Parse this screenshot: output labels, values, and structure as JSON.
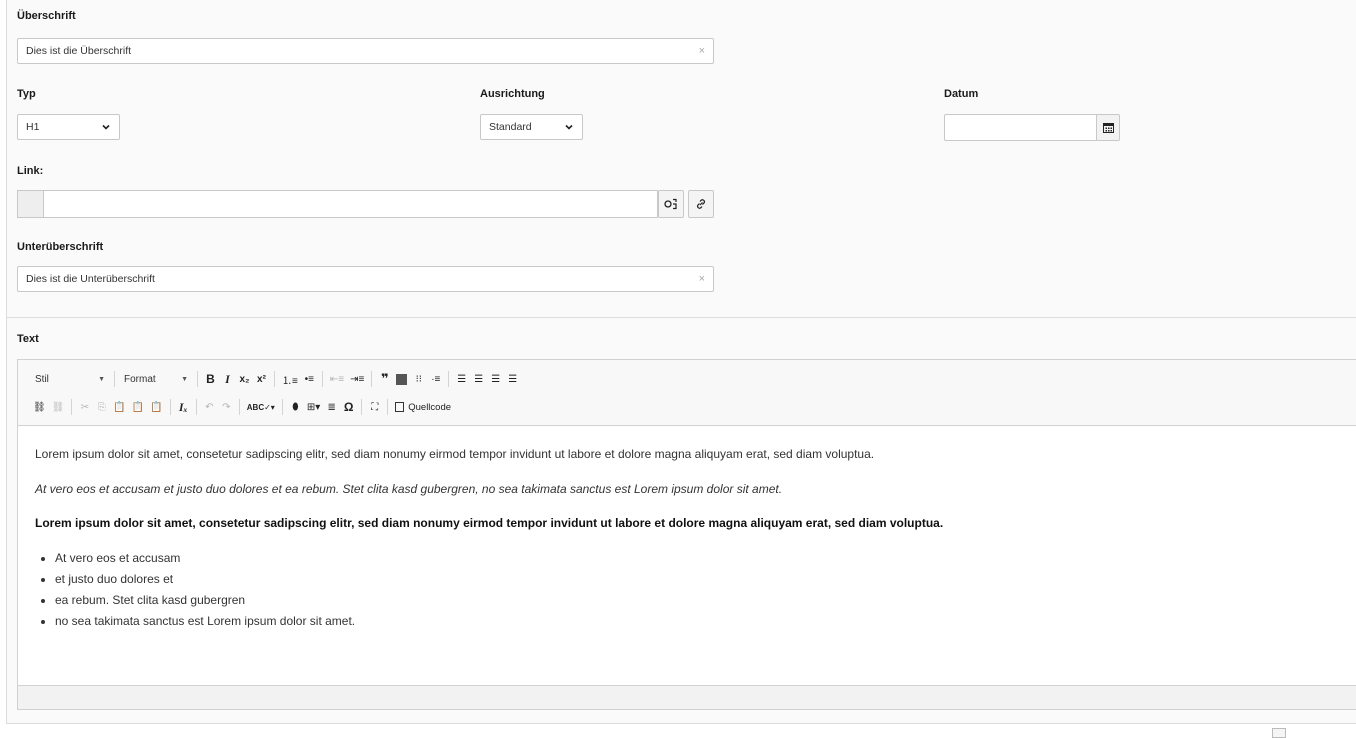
{
  "headline": {
    "label": "Überschrift",
    "value": "Dies ist die Überschrift",
    "clear": "×"
  },
  "type": {
    "label": "Typ",
    "selected": "H1"
  },
  "alignment": {
    "label": "Ausrichtung",
    "selected": "Standard"
  },
  "date": {
    "label": "Datum",
    "value": ""
  },
  "link": {
    "label": "Link:",
    "value": ""
  },
  "subheadline": {
    "label": "Unterüberschrift",
    "value": "Dies ist die Unterüberschrift",
    "clear": "×"
  },
  "text": {
    "label": "Text"
  },
  "editor": {
    "style_combo": "Stil",
    "format_combo": "Format",
    "source_label": "Quellcode",
    "paragraphs": [
      "Lorem ipsum dolor sit amet, consetetur sadipscing elitr, sed diam nonumy eirmod tempor invidunt ut labore et dolore magna aliquyam erat, sed diam voluptua.",
      "At vero eos et accusam et justo duo dolores et ea rebum. Stet clita kasd gubergren, no sea takimata sanctus est Lorem ipsum dolor sit amet.",
      "Lorem ipsum dolor sit amet, consetetur sadipscing elitr, sed diam nonumy eirmod tempor invidunt ut labore et dolore magna aliquyam erat, sed diam voluptua."
    ],
    "list": [
      "At vero eos et accusam",
      "et justo duo dolores et",
      "ea rebum. Stet clita kasd gubergren",
      "no sea takimata sanctus est Lorem ipsum dolor sit amet."
    ]
  }
}
